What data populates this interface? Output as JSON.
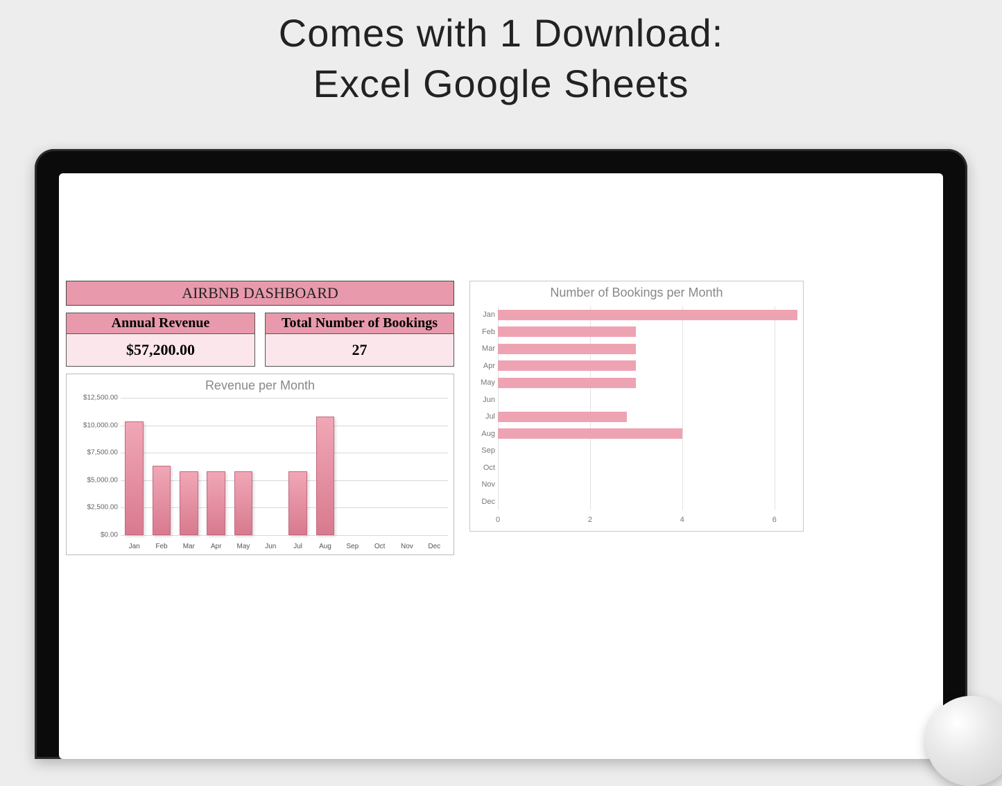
{
  "promo": {
    "line1": "Comes with 1 Download:",
    "line2": "Excel Google Sheets"
  },
  "dashboard": {
    "title": "AIRBNB DASHBOARD",
    "revenue_card": {
      "label": "Annual Revenue",
      "value": "$57,200.00"
    },
    "bookings_card": {
      "label": "Total Number of Bookings",
      "value": "27"
    }
  },
  "chart_data": [
    {
      "type": "bar",
      "orientation": "vertical",
      "title": "Revenue per Month",
      "xlabel": "",
      "ylabel": "",
      "ylim": [
        0,
        12500
      ],
      "y_ticks": [
        0,
        2500,
        5000,
        7500,
        10000,
        12500
      ],
      "y_tick_labels": [
        "$0.00",
        "$2,500.00",
        "$5,000.00",
        "$7,500.00",
        "$10,000.00",
        "$12,500.00"
      ],
      "categories": [
        "Jan",
        "Feb",
        "Mar",
        "Apr",
        "May",
        "Jun",
        "Jul",
        "Aug",
        "Sep",
        "Oct",
        "Nov",
        "Dec"
      ],
      "values": [
        10200,
        6200,
        5700,
        5700,
        5700,
        0,
        5700,
        10700,
        0,
        0,
        0,
        0
      ],
      "bar_color": "#e196a7"
    },
    {
      "type": "bar",
      "orientation": "horizontal",
      "title": "Number of Bookings per Month",
      "xlabel": "",
      "ylabel": "",
      "xlim": [
        0,
        6.5
      ],
      "x_ticks": [
        0,
        2,
        4,
        6
      ],
      "categories": [
        "Jan",
        "Feb",
        "Mar",
        "Apr",
        "May",
        "Jun",
        "Jul",
        "Aug",
        "Sep",
        "Oct",
        "Nov",
        "Dec"
      ],
      "values": [
        6.5,
        3,
        3,
        3,
        3,
        0,
        2.8,
        4,
        0,
        0,
        0,
        0
      ],
      "bar_color": "#eea3b3"
    }
  ]
}
